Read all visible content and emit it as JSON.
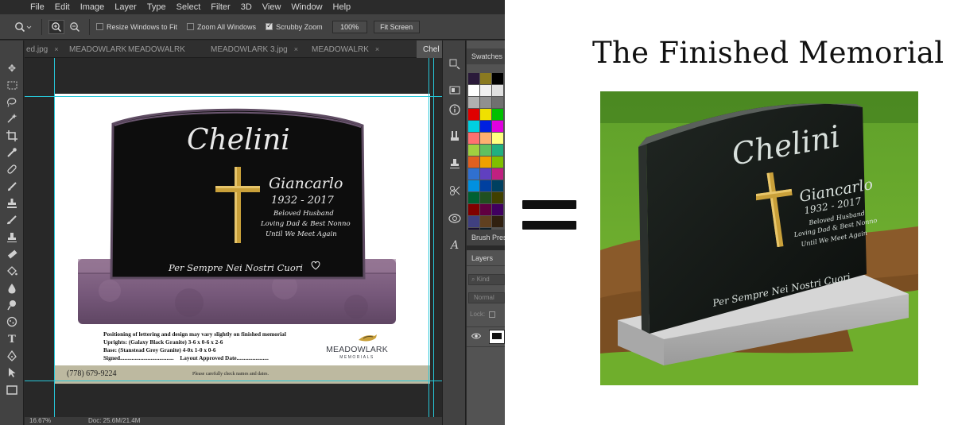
{
  "menu": [
    "File",
    "Edit",
    "Image",
    "Layer",
    "Type",
    "Select",
    "Filter",
    "3D",
    "View",
    "Window",
    "Help"
  ],
  "options_bar": {
    "resize_windows": "Resize Windows to Fit",
    "zoom_all": "Zoom All Windows",
    "scrubby_zoom": "Scrubby Zoom",
    "zoom_value": "100%",
    "fit_screen": "Fit Screen"
  },
  "tabs": [
    {
      "label": "ed.jpg",
      "close": "×"
    },
    {
      "label": "MEADOWLARK",
      "close": ""
    },
    {
      "label": "MEADOWALRK",
      "close": ""
    },
    {
      "label": "MEADOWLARK 3.jpg",
      "close": "×"
    },
    {
      "label": "MEADOWALRK",
      "close": "×"
    },
    {
      "label": "Chel",
      "close": ""
    }
  ],
  "panels": {
    "swatches": "Swatches",
    "brush_presets": "Brush Pres",
    "layers": "Layers",
    "kind": "Kind",
    "blend_mode": "Normal",
    "lock": "Lock:"
  },
  "status": {
    "zoom": "16.67%",
    "doc": "Doc: 25.6M/21.4M"
  },
  "monument": {
    "family_name": "Chelini",
    "first_name": "Giancarlo",
    "dates": "1932 - 2017",
    "epitaph_1": "Beloved Husband",
    "epitaph_2": "Loving Dad & Best Nonno",
    "epitaph_3": "Until We Meet Again",
    "motto": "Per Sempre Nei Nostri Cuori"
  },
  "spec": {
    "title": "Positioning of lettering and design may vary slightly on finished memorial",
    "upright": "Uprights: (Galaxy Black Granite) 3-6 x 0-6 x 2-6",
    "base": "Base: (Stanstead Grey Granite) 4-0x 1-0 x 0-6",
    "signed": "Signed.....................................",
    "approved": "Layout Approved Date......................"
  },
  "logo": {
    "name": "MEADOWLARK",
    "sub": "MEMORIALS"
  },
  "footer": {
    "phone": "(778) 679-9224",
    "note": "Please carefully check names and dates."
  },
  "headline": "The Finished Memorial",
  "colors": {
    "guide": "#27c7d8",
    "ps_bg": "#282828",
    "black_granite": "#0d0d0d",
    "purple_base": "#7a5c7e",
    "gold_cross": "#c9a03a"
  },
  "icons": [
    "zoom-icon",
    "zoom-in-icon",
    "zoom-out-icon",
    "move-icon",
    "marquee-icon",
    "lasso-icon",
    "magic-wand-icon",
    "crop-icon",
    "eyedropper-icon",
    "brush-icon",
    "clone-stamp-icon",
    "eraser-icon",
    "paint-bucket-icon",
    "blur-icon",
    "dodge-icon",
    "pen-icon",
    "type-icon",
    "path-select-icon",
    "rectangle-icon",
    "hand-icon",
    "cross-icon",
    "heart-icon",
    "bird-icon"
  ]
}
